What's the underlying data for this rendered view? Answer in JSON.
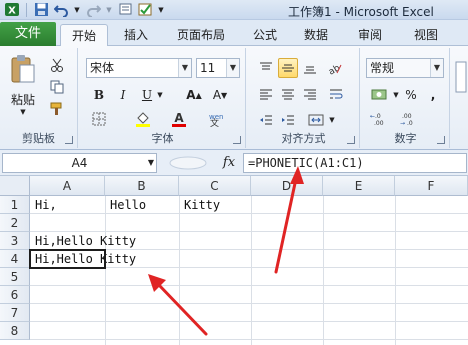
{
  "window": {
    "title": "工作簿1 - Microsoft Excel"
  },
  "tabs": [
    {
      "label": "文件"
    },
    {
      "label": "开始"
    },
    {
      "label": "插入"
    },
    {
      "label": "页面布局"
    },
    {
      "label": "公式"
    },
    {
      "label": "数据"
    },
    {
      "label": "审阅"
    },
    {
      "label": "视图"
    }
  ],
  "ribbon": {
    "clipboard": {
      "paste": "粘贴",
      "label": "剪贴板"
    },
    "font": {
      "name": "宋体",
      "size": "11",
      "label": "字体",
      "bold": "B",
      "italic": "I",
      "underline": "U"
    },
    "alignment": {
      "label": "对齐方式"
    },
    "number": {
      "format": "常规",
      "label": "数字",
      "percent": "%"
    }
  },
  "formula_bar": {
    "name_box": "A4",
    "fx": "fx",
    "formula": "=PHONETIC(A1:C1)"
  },
  "columns": [
    "A",
    "B",
    "C",
    "D",
    "E",
    "F"
  ],
  "rows": [
    "1",
    "2",
    "3",
    "4",
    "5",
    "6",
    "7",
    "8"
  ],
  "cells": {
    "A1": "Hi,",
    "B1": "Hello",
    "C1": "Kitty",
    "A3": "Hi,Hello Kitty",
    "A4": "Hi,Hello Kitty"
  },
  "colors": {
    "file_tab": "#2b7d2f",
    "arrow": "#e02424",
    "selection_header": "#f2c965"
  }
}
